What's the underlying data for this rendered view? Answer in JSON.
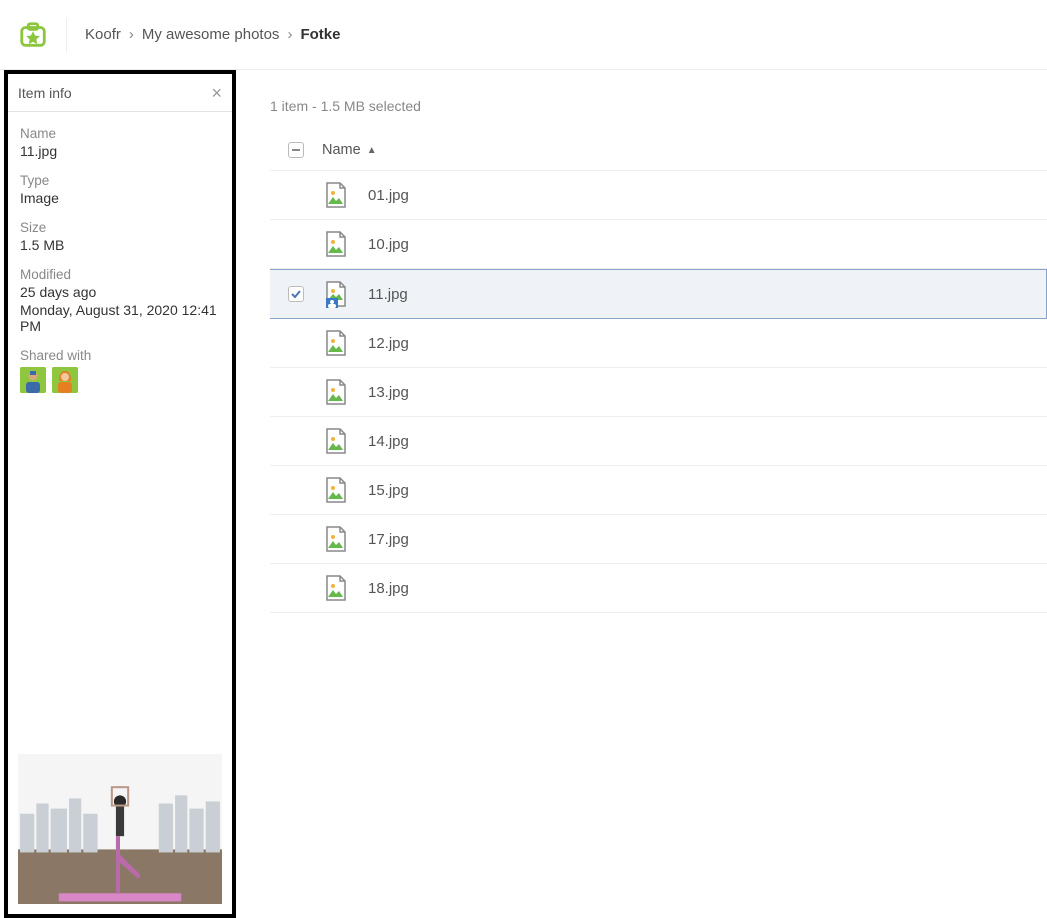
{
  "breadcrumb": {
    "root": "Koofr",
    "folder": "My awesome photos",
    "current": "Fotke"
  },
  "panel": {
    "title": "Item info",
    "name_label": "Name",
    "name_value": "11.jpg",
    "type_label": "Type",
    "type_value": "Image",
    "size_label": "Size",
    "size_value": "1.5 MB",
    "modified_label": "Modified",
    "modified_rel": "25 days ago",
    "modified_abs": "Monday, August 31, 2020 12:41 PM",
    "shared_label": "Shared with"
  },
  "status": "1 item - 1.5 MB selected",
  "list": {
    "name_header": "Name",
    "files": [
      {
        "name": "01.jpg",
        "selected": false
      },
      {
        "name": "10.jpg",
        "selected": false
      },
      {
        "name": "11.jpg",
        "selected": true
      },
      {
        "name": "12.jpg",
        "selected": false
      },
      {
        "name": "13.jpg",
        "selected": false
      },
      {
        "name": "14.jpg",
        "selected": false
      },
      {
        "name": "15.jpg",
        "selected": false
      },
      {
        "name": "17.jpg",
        "selected": false
      },
      {
        "name": "18.jpg",
        "selected": false
      }
    ]
  }
}
